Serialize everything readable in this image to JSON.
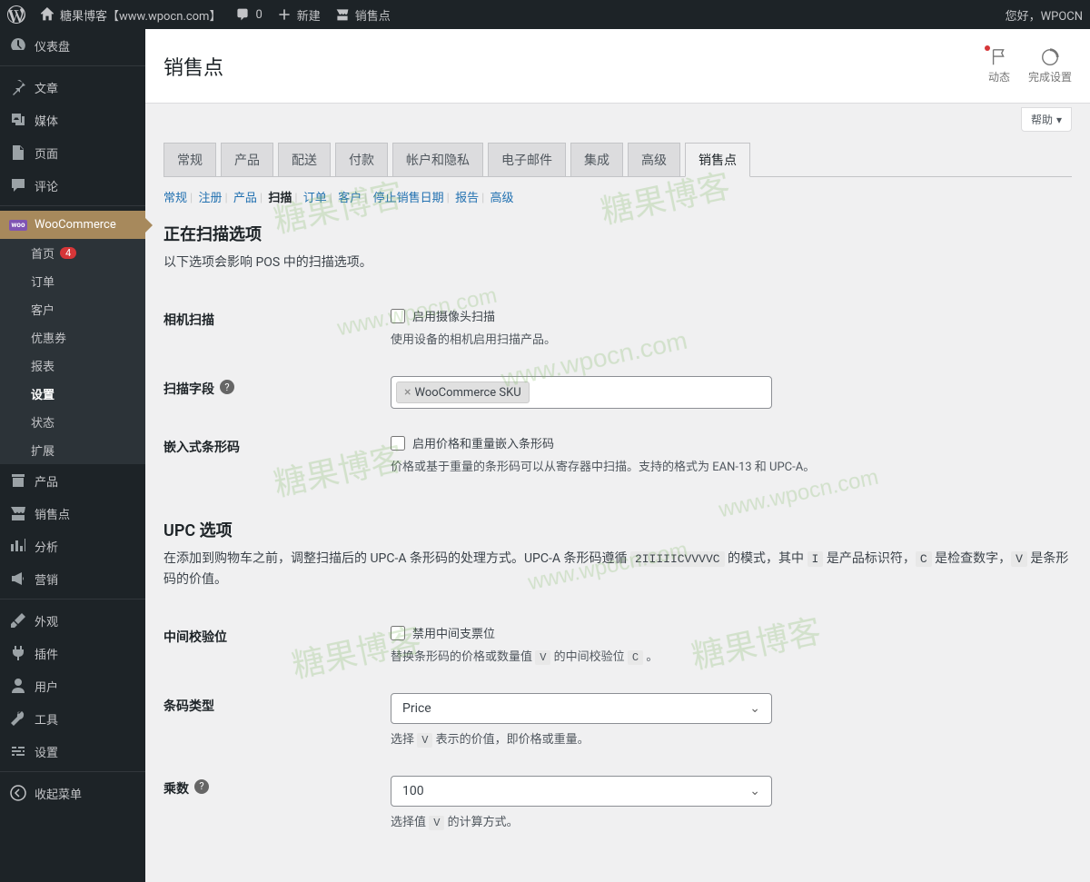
{
  "toolbar": {
    "site_name": "糖果博客【www.wpocn.com】",
    "comments_count": "0",
    "new_label": "新建",
    "pos_label": "销售点",
    "howdy": "您好，WPOCN"
  },
  "sidebar": {
    "dashboard": "仪表盘",
    "posts": "文章",
    "media": "媒体",
    "pages": "页面",
    "comments": "评论",
    "woocommerce": "WooCommerce",
    "woo_sub": {
      "home": "首页",
      "home_badge": "4",
      "orders": "订单",
      "customers": "客户",
      "coupons": "优惠券",
      "reports": "报表",
      "settings": "设置",
      "status": "状态",
      "extensions": "扩展"
    },
    "products": "产品",
    "pos": "销售点",
    "analytics": "分析",
    "marketing": "营销",
    "appearance": "外观",
    "plugins": "插件",
    "users": "用户",
    "tools": "工具",
    "settings": "设置",
    "collapse": "收起菜单"
  },
  "header": {
    "title": "销售点",
    "activity": "动态",
    "finish_setup": "完成设置",
    "help": "帮助"
  },
  "tabs": {
    "general": "常规",
    "products": "产品",
    "shipping": "配送",
    "payments": "付款",
    "accounts": "帐户和隐私",
    "emails": "电子邮件",
    "integration": "集成",
    "advanced": "高级",
    "pos": "销售点"
  },
  "subtabs": {
    "general": "常规",
    "register": "注册",
    "products": "产品",
    "scanning": "扫描",
    "orders": "订单",
    "customers": "客户",
    "end_of_sale": "停止销售日期",
    "reports": "报告",
    "advanced": "高级"
  },
  "sections": {
    "scanning_options": {
      "title": "正在扫描选项",
      "desc": "以下选项会影响 POS 中的扫描选项。"
    },
    "camera_scanning": {
      "label": "相机扫描",
      "checkbox_label": "启用摄像头扫描",
      "desc": "使用设备的相机启用扫描产品。"
    },
    "scanning_fields": {
      "label": "扫描字段",
      "tag": "WooCommerce SKU"
    },
    "embedded_barcodes": {
      "label": "嵌入式条形码",
      "checkbox_label": "启用价格和重量嵌入条形码",
      "desc": "价格或基于重量的条形码可以从寄存器中扫描。支持的格式为 EAN-13 和 UPC-A。"
    },
    "upc_options": {
      "title": "UPC 选项",
      "desc_pre": "在添加到购物车之前，调整扫描后的 UPC-A 条形码的处理方式。UPC-A 条形码遵循 ",
      "desc_code1": "2IIIIICVVVVC",
      "desc_mid1": " 的模式，其中 ",
      "desc_code2": "I",
      "desc_mid2": " 是产品标识符，",
      "desc_code3": "C",
      "desc_mid3": " 是检查数字，",
      "desc_code4": "V",
      "desc_end": " 是条形码的价值。"
    },
    "middle_check": {
      "label": "中间校验位",
      "checkbox_label": "禁用中间支票位",
      "desc_pre": "替换条形码的价格或数量值 ",
      "desc_code1": "V",
      "desc_mid": " 的中间校验位 ",
      "desc_code2": "C",
      "desc_end": " 。"
    },
    "barcode_type": {
      "label": "条码类型",
      "value": "Price",
      "desc_pre": "选择 ",
      "desc_code": "V",
      "desc_end": " 表示的价值，即价格或重量。"
    },
    "multiplier": {
      "label": "乘数",
      "value": "100",
      "desc_pre": "选择值 ",
      "desc_code": "V",
      "desc_end": " 的计算方式。"
    }
  },
  "watermarks": [
    "糖果博客",
    "www.wpocn.com"
  ]
}
